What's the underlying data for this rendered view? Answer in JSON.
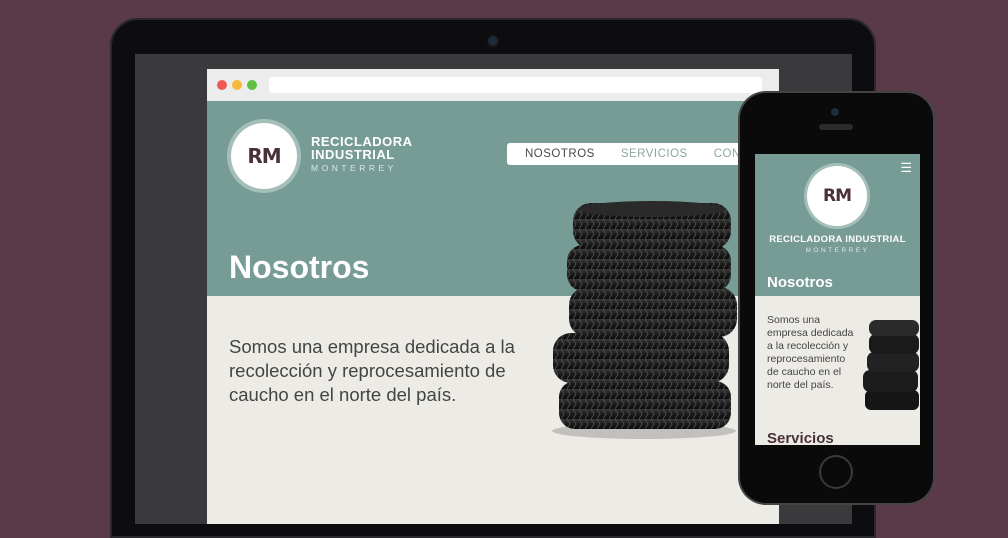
{
  "colors": {
    "background": "#5a3a48",
    "hero": "#779c96",
    "content": "#edebe6",
    "brand_dark": "#4a3038"
  },
  "logo": {
    "mark": "RM"
  },
  "brand": {
    "line1": "RECICLADORA",
    "line2": "INDUSTRIAL",
    "sub": "MONTERREY",
    "mobile_name": "RECICLADORA INDUSTRIAL"
  },
  "nav": {
    "items": [
      {
        "label": "NOSOTROS"
      },
      {
        "label": "SERVICIOS"
      },
      {
        "label": "CONTACTO"
      }
    ]
  },
  "desktop": {
    "title": "Nosotros",
    "body": "Somos una empresa dedicada a la recolección y reprocesamiento de caucho en el norte del país."
  },
  "mobile": {
    "menu_icon": "hamburger-icon",
    "title": "Nosotros",
    "body": "Somos una empresa dedicada a la recolección y reprocesamiento de caucho en el norte del país.",
    "next_section": "Servicios"
  }
}
